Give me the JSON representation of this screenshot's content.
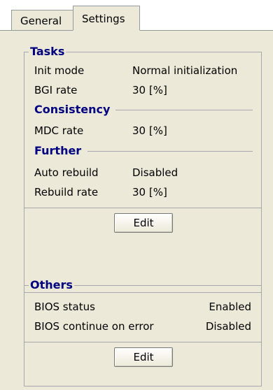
{
  "tabs": [
    {
      "label": "General"
    },
    {
      "label": "Settings",
      "active": true
    }
  ],
  "tasks_group": {
    "title": "Tasks",
    "tasks": [
      {
        "label": "Init mode",
        "value": "Normal initialization"
      },
      {
        "label": "BGI rate",
        "value": "30 [%]"
      }
    ],
    "consistency": {
      "title": "Consistency",
      "rows": [
        {
          "label": "MDC rate",
          "value": "30 [%]"
        }
      ]
    },
    "further": {
      "title": "Further",
      "rows": [
        {
          "label": "Auto rebuild",
          "value": "Disabled"
        },
        {
          "label": "Rebuild rate",
          "value": "30 [%]"
        }
      ]
    },
    "edit_label": "Edit"
  },
  "others_group": {
    "title": "Others",
    "rows": [
      {
        "label": "BIOS status",
        "value": "Enabled"
      },
      {
        "label": "BIOS continue on error",
        "value": "Disabled"
      }
    ],
    "edit_label": "Edit"
  },
  "colors": {
    "panel_bg": "#ece9d8",
    "group_title": "#000080",
    "border": "#a7a6aa"
  }
}
